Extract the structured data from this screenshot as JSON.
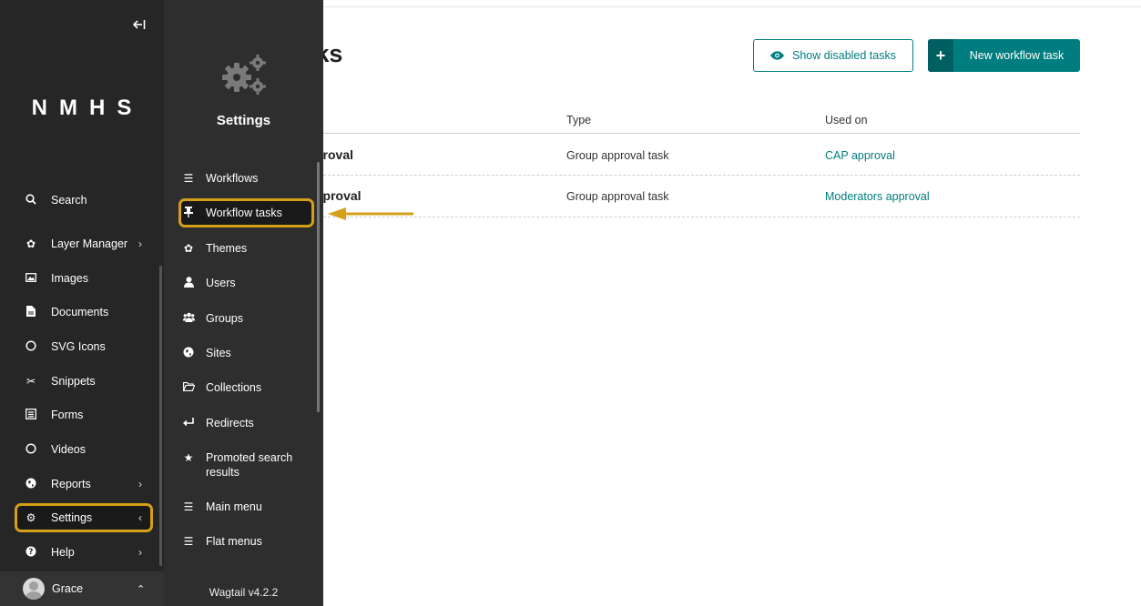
{
  "header": {
    "title": "w tasks",
    "show_disabled_label": "Show disabled tasks",
    "new_task_label": "New workflow task"
  },
  "table": {
    "columns": [
      "Type",
      "Used on"
    ],
    "rows": [
      {
        "title": "proval",
        "type": "Group approval task",
        "used_on": "CAP approval"
      },
      {
        "title": "pproval",
        "type": "Group approval task",
        "used_on": "Moderators approval"
      }
    ]
  },
  "sidebar": {
    "logo": "NMHS",
    "collapse_icon": "collapse-left-icon",
    "items": [
      {
        "label": "Search",
        "icon": "search-icon"
      },
      {
        "label": "Layer Manager",
        "icon": "cog-icon",
        "chevron": "›"
      },
      {
        "label": "Images",
        "icon": "image-icon"
      },
      {
        "label": "Documents",
        "icon": "document-icon"
      },
      {
        "label": "SVG Icons",
        "icon": "circle-icon"
      },
      {
        "label": "Snippets",
        "icon": "snippet-icon"
      },
      {
        "label": "Forms",
        "icon": "form-icon"
      },
      {
        "label": "Videos",
        "icon": "circle-icon"
      },
      {
        "label": "Reports",
        "icon": "globe-icon",
        "chevron": "›"
      },
      {
        "label": "Settings",
        "icon": "cogs-icon",
        "chevron": "‹"
      },
      {
        "label": "Help",
        "icon": "help-icon",
        "chevron": "›"
      }
    ],
    "account": {
      "name": "Grace"
    }
  },
  "submenu": {
    "title": "Settings",
    "items": [
      {
        "label": "Workflows",
        "icon": "list-icon"
      },
      {
        "label": "Workflow tasks",
        "icon": "pin-icon"
      },
      {
        "label": "Themes",
        "icon": "cog-icon"
      },
      {
        "label": "Users",
        "icon": "user-icon"
      },
      {
        "label": "Groups",
        "icon": "group-icon"
      },
      {
        "label": "Sites",
        "icon": "globe-icon"
      },
      {
        "label": "Collections",
        "icon": "folder-icon"
      },
      {
        "label": "Redirects",
        "icon": "redirect-icon"
      },
      {
        "label": "Promoted search results",
        "icon": "star-icon"
      },
      {
        "label": "Main menu",
        "icon": "menu-icon"
      },
      {
        "label": "Flat menus",
        "icon": "menu-icon"
      }
    ],
    "footer": "Wagtail v4.2.2"
  },
  "colors": {
    "accent": "#007d7e",
    "highlight": "#d4a017",
    "sidebar_bg": "#262626",
    "submenu_bg": "#2e2e2e"
  }
}
